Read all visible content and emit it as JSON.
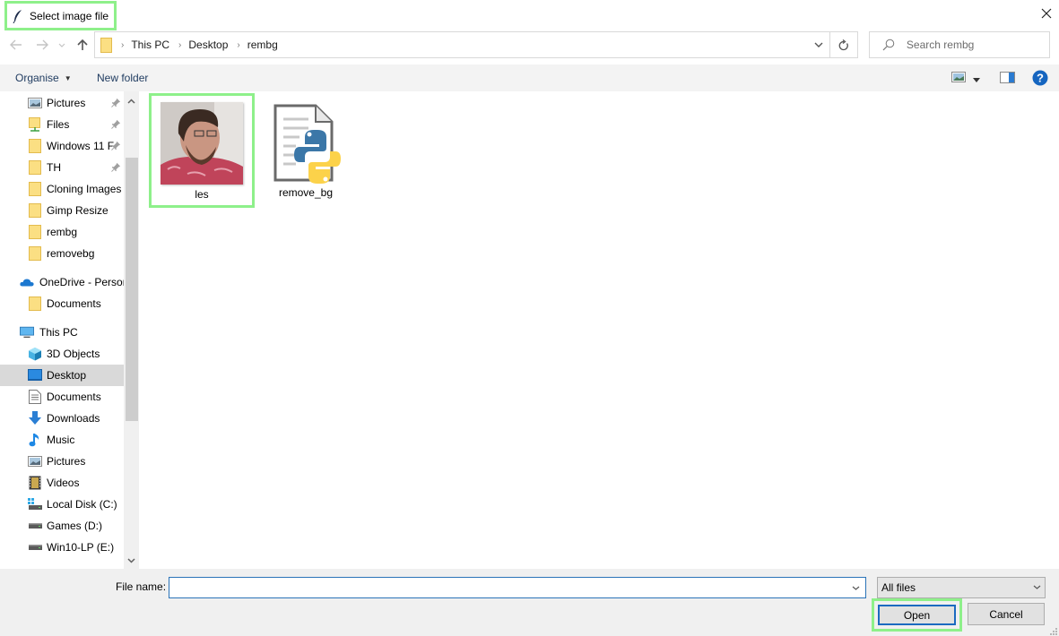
{
  "window": {
    "title": "Select image file",
    "title_icon": "feather-icon",
    "close_icon": "close-icon"
  },
  "nav": {
    "back_icon": "arrow-left-icon",
    "forward_icon": "arrow-right-icon",
    "recent_icon": "chevron-down-icon",
    "up_icon": "arrow-up-icon"
  },
  "address": {
    "breadcrumbs": [
      "This PC",
      "Desktop",
      "rembg"
    ],
    "separator": "›",
    "dropdown_icon": "chevron-down-icon",
    "refresh_icon": "refresh-icon"
  },
  "search": {
    "placeholder": "Search rembg",
    "value": ""
  },
  "toolbar": {
    "organise_label": "Organise",
    "new_folder_label": "New folder",
    "view_icon": "view-options-icon",
    "preview_pane_icon": "preview-pane-icon",
    "help_icon": "help-icon"
  },
  "sidebar": {
    "items": [
      {
        "label": "Pictures",
        "icon": "pictures-icon",
        "pinned": true,
        "level": 1
      },
      {
        "label": "Files",
        "icon": "network-folder-icon",
        "pinned": true,
        "level": 1
      },
      {
        "label": "Windows 11 F",
        "icon": "folder-icon",
        "pinned": true,
        "level": 1
      },
      {
        "label": "TH",
        "icon": "folder-icon",
        "pinned": true,
        "level": 1
      },
      {
        "label": "Cloning Images",
        "icon": "folder-icon",
        "pinned": false,
        "level": 1
      },
      {
        "label": "Gimp Resize",
        "icon": "folder-icon",
        "pinned": false,
        "level": 1
      },
      {
        "label": "rembg",
        "icon": "folder-icon",
        "pinned": false,
        "level": 1
      },
      {
        "label": "removebg",
        "icon": "folder-icon",
        "pinned": false,
        "level": 1
      },
      {
        "label": "OneDrive - Persor",
        "icon": "onedrive-icon",
        "pinned": false,
        "level": 0
      },
      {
        "label": "Documents",
        "icon": "folder-icon",
        "pinned": false,
        "level": 1
      },
      {
        "label": "This PC",
        "icon": "computer-icon",
        "pinned": false,
        "level": 0
      },
      {
        "label": "3D Objects",
        "icon": "3d-objects-icon",
        "pinned": false,
        "level": 1
      },
      {
        "label": "Desktop",
        "icon": "desktop-icon",
        "pinned": false,
        "level": 1,
        "selected": true
      },
      {
        "label": "Documents",
        "icon": "documents-icon",
        "pinned": false,
        "level": 1
      },
      {
        "label": "Downloads",
        "icon": "downloads-icon",
        "pinned": false,
        "level": 1
      },
      {
        "label": "Music",
        "icon": "music-icon",
        "pinned": false,
        "level": 1
      },
      {
        "label": "Pictures",
        "icon": "pictures-icon",
        "pinned": false,
        "level": 1
      },
      {
        "label": "Videos",
        "icon": "videos-icon",
        "pinned": false,
        "level": 1
      },
      {
        "label": "Local Disk (C:)",
        "icon": "system-drive-icon",
        "pinned": false,
        "level": 1
      },
      {
        "label": "Games (D:)",
        "icon": "drive-icon",
        "pinned": false,
        "level": 1
      },
      {
        "label": "Win10-LP (E:)",
        "icon": "drive-icon",
        "pinned": false,
        "level": 1
      }
    ]
  },
  "files": [
    {
      "name": "les",
      "type": "image",
      "highlighted": true
    },
    {
      "name": "remove_bg",
      "type": "python-script",
      "highlighted": false
    }
  ],
  "footer": {
    "file_name_label": "File name:",
    "file_name_value": "",
    "file_type_selected": "All files",
    "open_label": "Open",
    "cancel_label": "Cancel"
  },
  "colors": {
    "highlight_outline": "#8ef08a",
    "selection_bg": "#d9d9d9",
    "focus_blue": "#1b6ac0",
    "footer_bg": "#f0f0f0",
    "toolbar_bg": "#f3f3f3"
  }
}
